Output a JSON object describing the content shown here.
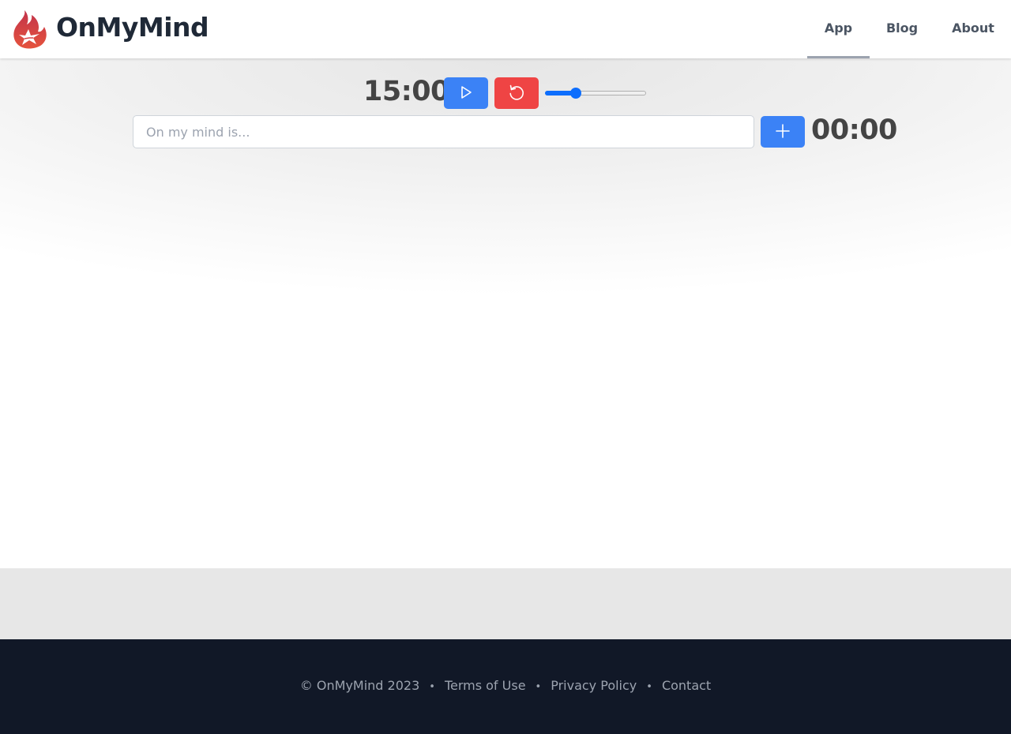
{
  "header": {
    "brand": "OnMyMind",
    "logo_icon": "flame-logo-icon",
    "nav": [
      {
        "label": "App",
        "active": true
      },
      {
        "label": "Blog",
        "active": false
      },
      {
        "label": "About",
        "active": false
      }
    ]
  },
  "timer": {
    "countdown": "15:00",
    "play_icon": "play-icon",
    "reset_icon": "reset-icon",
    "duration_slider_fraction": 0.28
  },
  "entry": {
    "placeholder": "On my mind is...",
    "value": "",
    "add_icon": "plus-icon",
    "elapsed": "00:00"
  },
  "footer": {
    "copyright": "© OnMyMind 2023",
    "separator": "•",
    "links": [
      "Terms of Use",
      "Privacy Policy",
      "Contact"
    ]
  },
  "colors": {
    "primary": "#3b82f6",
    "danger": "#ef4444",
    "slider": "#0d6efd",
    "footer_bg": "#111827",
    "text_dark": "#1f2937"
  }
}
